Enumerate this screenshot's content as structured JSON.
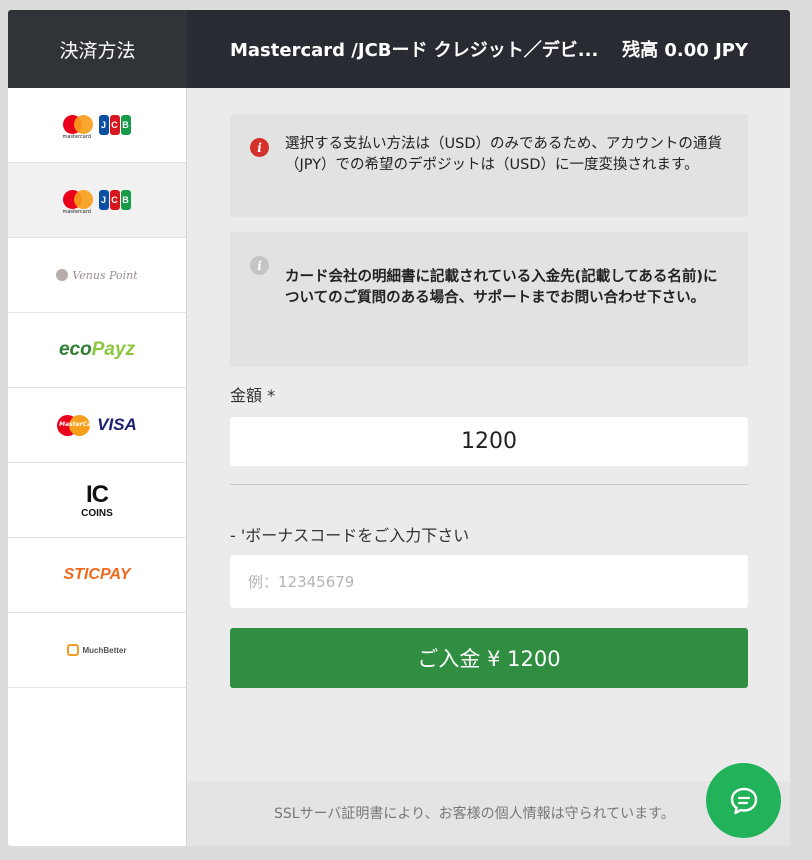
{
  "header": {
    "left_title": "決済方法",
    "method_title": "Mastercard /JCBード クレジット／デビ...",
    "balance": "残高 0.00 JPY"
  },
  "sidebar": {
    "items": [
      {
        "logo": "mastercard-jcb",
        "mc_text": "mastercard",
        "jcb": [
          "J",
          "C",
          "B"
        ],
        "active": false
      },
      {
        "logo": "mastercard-jcb",
        "mc_text": "mastercard",
        "jcb": [
          "J",
          "C",
          "B"
        ],
        "active": true
      },
      {
        "logo": "venus-point",
        "text": "Venus Point"
      },
      {
        "logo": "ecopayz",
        "text_a": "eco",
        "text_b": "Payz"
      },
      {
        "logo": "mastercard-visa",
        "mc_text": "MasterCard",
        "visa": "VISA"
      },
      {
        "logo": "iocoins",
        "mark": "IC",
        "name": "COINS"
      },
      {
        "logo": "sticpay",
        "text": "STICPAY"
      },
      {
        "logo": "muchbetter",
        "text": "MuchBetter"
      }
    ]
  },
  "notices": {
    "warning": "選択する支払い方法は（USD）のみであるため、アカウントの通貨（JPY）での希望のデポジットは（USD）に一度変換されます。",
    "info": "カード会社の明細書に記載されている入金先(記載してある名前)についてのご質問のある場合、サポートまでお問い合わせ下さい。"
  },
  "form": {
    "amount_label": "金額 *",
    "amount_value": "1200",
    "bonus_label": "- 'ボーナスコードをご入力下さい",
    "bonus_placeholder": "例：12345679",
    "submit_label": "ご入金 ¥ 1200"
  },
  "footer": {
    "ssl_text": "SSLサーバ証明書により、お客様の個人情報は守られています。"
  },
  "colors": {
    "header_bg": "#282c32",
    "submit_green": "#2f8e40",
    "chat_green": "#22b35a",
    "warning_red": "#d3312b"
  }
}
